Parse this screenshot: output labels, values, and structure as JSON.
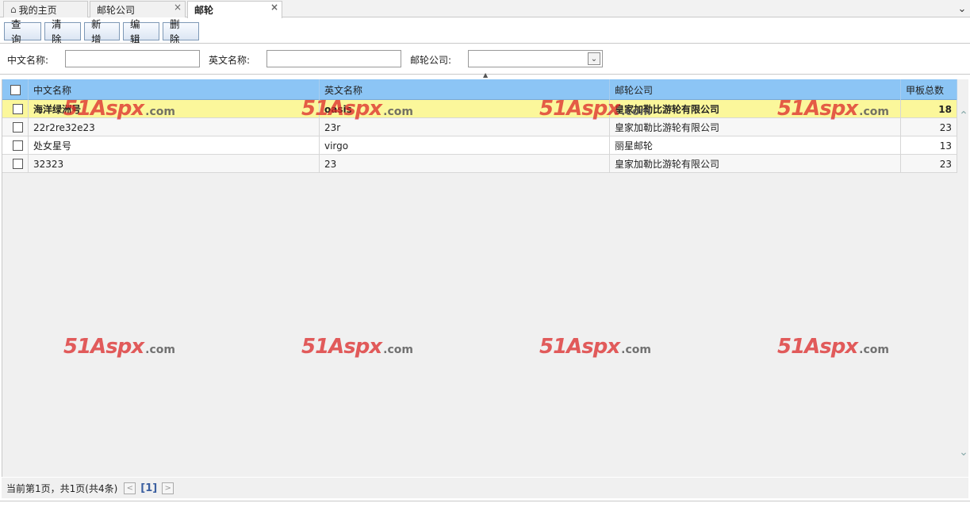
{
  "tabs": [
    {
      "label": "我的主页",
      "icon": "home-icon"
    },
    {
      "label": "邮轮公司",
      "closable": true
    },
    {
      "label": "邮轮",
      "closable": true,
      "active": true
    }
  ],
  "tab_close_glyph": "×",
  "tab_scroll_glyph": "⌄",
  "toolbar": {
    "query": "查询",
    "clear": "清除",
    "add": "新增",
    "edit": "编辑",
    "delete": "删除"
  },
  "search": {
    "cn_name_label": "中文名称:",
    "cn_name_value": "",
    "en_name_label": "英文名称:",
    "en_name_value": "",
    "company_label": "邮轮公司:",
    "company_value": ""
  },
  "grid": {
    "columns": [
      "中文名称",
      "英文名称",
      "邮轮公司",
      "甲板总数"
    ],
    "rows": [
      {
        "cn": "海洋绿洲号",
        "en": "oasis",
        "company": "皇家加勒比游轮有限公司",
        "decks": "18",
        "selected": true
      },
      {
        "cn": "22r2re32e23",
        "en": "23r",
        "company": "皇家加勒比游轮有限公司",
        "decks": "23"
      },
      {
        "cn": "处女星号",
        "en": "virgo",
        "company": "丽星邮轮",
        "decks": "13"
      },
      {
        "cn": "32323",
        "en": "23",
        "company": "皇家加勒比游轮有限公司",
        "decks": "23"
      }
    ]
  },
  "pager": {
    "summary": "当前第1页，共1页(共4条)",
    "current": "[1]",
    "prev_glyph": "<",
    "next_glyph": ">"
  },
  "watermark": {
    "main": "51Aspx",
    "suffix": ".com"
  },
  "colors": {
    "header": "#8cc5f5",
    "selected_row": "#fbf79b",
    "watermark": "#dc2828"
  }
}
